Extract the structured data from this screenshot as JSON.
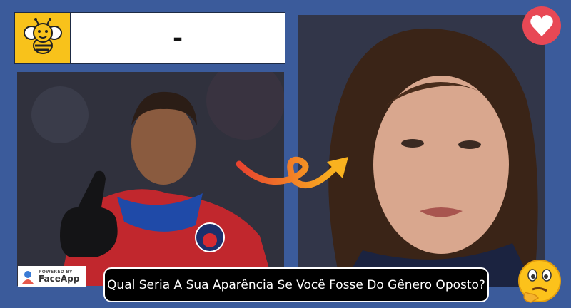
{
  "header": {
    "title": "-"
  },
  "watermark": {
    "powered_by": "POWERED BY",
    "brand": "FaceApp"
  },
  "caption": {
    "text": "Qual Seria A Sua Aparência Se Você Fosse Do Gênero Oposto?"
  },
  "photos": {
    "left": "photo-before",
    "right": "photo-after"
  },
  "colors": {
    "background": "#3b5b9b",
    "bee_box": "#f8c21b",
    "heart": "#e84855",
    "arrow_start": "#e8432f",
    "arrow_end": "#f9b21f"
  },
  "icons": {
    "logo": "bee-logo-icon",
    "like": "heart-icon",
    "transform": "curved-arrow-icon",
    "reaction": "thinking-emoji-icon"
  }
}
